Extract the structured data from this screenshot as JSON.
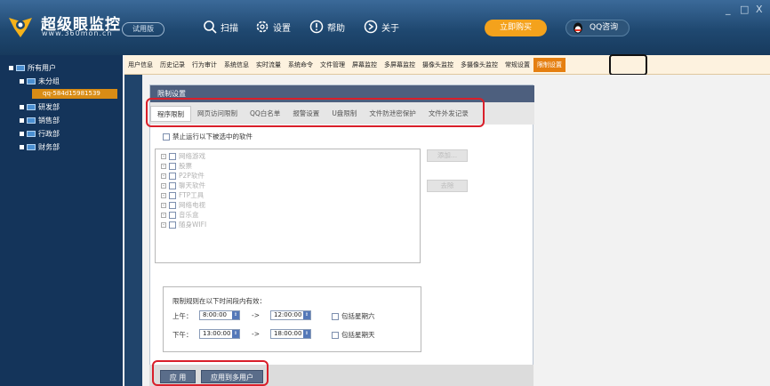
{
  "header": {
    "title": "超级眼监控",
    "url": "www.360mon.cn",
    "trial_badge": "试用版",
    "nav": [
      {
        "label": "扫描",
        "icon": "search-icon"
      },
      {
        "label": "设置",
        "icon": "gear-icon"
      },
      {
        "label": "帮助",
        "icon": "help-icon"
      },
      {
        "label": "关于",
        "icon": "about-icon"
      }
    ],
    "buy_label": "立即购买",
    "qq_label": "QQ咨询",
    "min_label": "_",
    "max_label": "□",
    "close_label": "X"
  },
  "sidebar": {
    "root": "所有用户",
    "groups": [
      "未分组",
      "研发部",
      "销售部",
      "行政部",
      "财务部"
    ],
    "selected_user": "qq-584d15981539"
  },
  "top_tabs": [
    "用户信息",
    "历史记录",
    "行为审计",
    "系统信息",
    "实时流量",
    "系统命令",
    "文件管理",
    "屏幕监控",
    "多屏幕监控",
    "摄像头监控",
    "多摄像头监控",
    "常规设置",
    "限制设置"
  ],
  "active_top_tab": "限制设置",
  "panel": {
    "title": "限制设置",
    "subtabs": [
      "程序限制",
      "网页访问限制",
      "QQ白名单",
      "报警设置",
      "U盘限制",
      "文件防泄密保护",
      "文件外发记录"
    ],
    "active_subtab": "程序限制",
    "forbid_label": "禁止运行以下被选中的软件",
    "software": [
      "网络游戏",
      "股票",
      "P2P软件",
      "聊天软件",
      "FTP工具",
      "网络电视",
      "音乐盒",
      "随身WIFI"
    ],
    "add_label": "添加...",
    "remove_label": "去除",
    "time_title": "限制规则在以下时间段内有效：",
    "am_label": "上午：",
    "pm_label": "下午：",
    "am_start": "8:00:00",
    "am_end": "12:00:00",
    "pm_start": "13:00:00",
    "pm_end": "18:00:00",
    "arrow": "->",
    "sat_label": "包括星期六",
    "sun_label": "包括星期天",
    "apply_label": "应 用",
    "apply_multi_label": "应用到多用户"
  }
}
